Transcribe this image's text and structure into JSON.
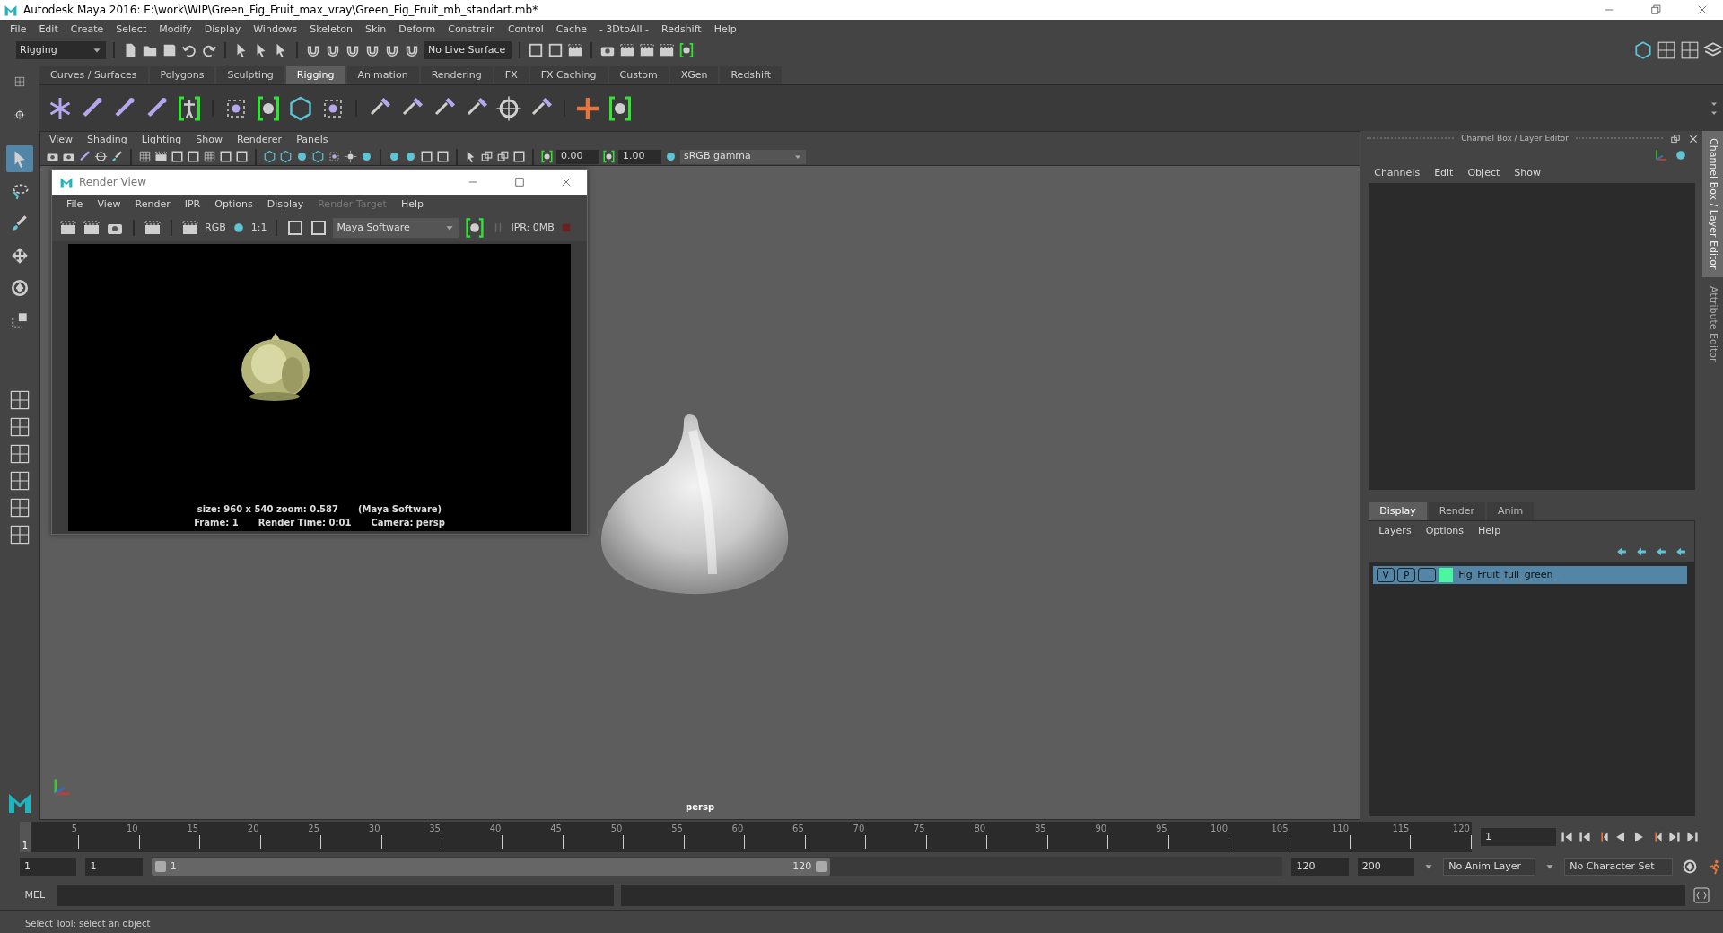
{
  "window": {
    "title": "Autodesk Maya 2016: E:\\work\\WIP\\Green_Fig_Fruit_max_vray\\Green_Fig_Fruit_mb_standart.mb*"
  },
  "menu_bar": [
    "File",
    "Edit",
    "Create",
    "Select",
    "Modify",
    "Display",
    "Windows",
    "Skeleton",
    "Skin",
    "Deform",
    "Constrain",
    "Control",
    "Cache",
    "- 3DtoAll -",
    "Redshift",
    "Help"
  ],
  "status_line": {
    "menu_set": "Rigging",
    "live_surface": "No Live Surface"
  },
  "shelf_tabs": [
    {
      "label": "Curves / Surfaces",
      "selected": false
    },
    {
      "label": "Polygons",
      "selected": false
    },
    {
      "label": "Sculpting",
      "selected": false
    },
    {
      "label": "Rigging",
      "selected": true
    },
    {
      "label": "Animation",
      "selected": false
    },
    {
      "label": "Rendering",
      "selected": false
    },
    {
      "label": "FX",
      "selected": false
    },
    {
      "label": "FX Caching",
      "selected": false
    },
    {
      "label": "Custom",
      "selected": false
    },
    {
      "label": "XGen",
      "selected": false
    },
    {
      "label": "Redshift",
      "selected": false
    }
  ],
  "toolbox": [
    {
      "kind": "select",
      "selected": true
    },
    {
      "kind": "lasso",
      "selected": false
    },
    {
      "kind": "paint",
      "selected": false
    },
    {
      "kind": "move",
      "selected": false
    },
    {
      "kind": "rotate",
      "selected": false
    },
    {
      "kind": "scale",
      "selected": false
    }
  ],
  "viewport": {
    "menus": [
      "View",
      "Shading",
      "Lighting",
      "Show",
      "Renderer",
      "Panels"
    ],
    "exposure": "0.00",
    "gamma": "1.00",
    "color_space": "sRGB gamma",
    "camera_label": "persp"
  },
  "render_view": {
    "title": "Render View",
    "menus": [
      {
        "label": "File",
        "disabled": false
      },
      {
        "label": "View",
        "disabled": false
      },
      {
        "label": "Render",
        "disabled": false
      },
      {
        "label": "IPR",
        "disabled": false
      },
      {
        "label": "Options",
        "disabled": false
      },
      {
        "label": "Display",
        "disabled": false
      },
      {
        "label": "Render Target",
        "disabled": true
      },
      {
        "label": "Help",
        "disabled": false
      }
    ],
    "rgb_label": "RGB",
    "zoom_label": "1:1",
    "renderer": "Maya Software",
    "ipr": "IPR: 0MB",
    "info_lines": [
      [
        "size: 960 x 540 zoom: 0.587",
        "(Maya Software)"
      ],
      [
        "Frame: 1",
        "Render Time: 0:01",
        "Camera: persp"
      ]
    ]
  },
  "channel_box": {
    "title": "Channel Box / Layer Editor",
    "menus": [
      "Channels",
      "Edit",
      "Object",
      "Show"
    ]
  },
  "layer_editor": {
    "tabs": [
      {
        "label": "Display",
        "selected": true
      },
      {
        "label": "Render",
        "selected": false
      },
      {
        "label": "Anim",
        "selected": false
      }
    ],
    "menus": [
      "Layers",
      "Options",
      "Help"
    ],
    "layers": [
      {
        "visibility": "V",
        "playback": "P",
        "color": "#4cf5a0",
        "name": "Fig_Fruit_full_green_",
        "selected": true
      }
    ]
  },
  "side_tabs": [
    {
      "label": "Channel Box / Layer Editor",
      "selected": true
    },
    {
      "label": "Attribute Editor",
      "selected": false
    }
  ],
  "timeline": {
    "start_label": "1",
    "ticks": [
      "5",
      "10",
      "15",
      "20",
      "25",
      "30",
      "35",
      "40",
      "45",
      "50",
      "55",
      "60",
      "65",
      "70",
      "75",
      "80",
      "85",
      "90",
      "95",
      "100",
      "105",
      "110",
      "115",
      "120"
    ],
    "current_frame": "1"
  },
  "range": {
    "level": 0.6,
    "start": "1",
    "playback_start": "1",
    "slider_start": "1",
    "slider_end": "120",
    "playback_end": "120",
    "end": "200",
    "anim_layer": "No Anim Layer",
    "character_set": "No Character Set"
  },
  "command_line": {
    "label": "MEL"
  },
  "help_line": "Select Tool: select an object"
}
